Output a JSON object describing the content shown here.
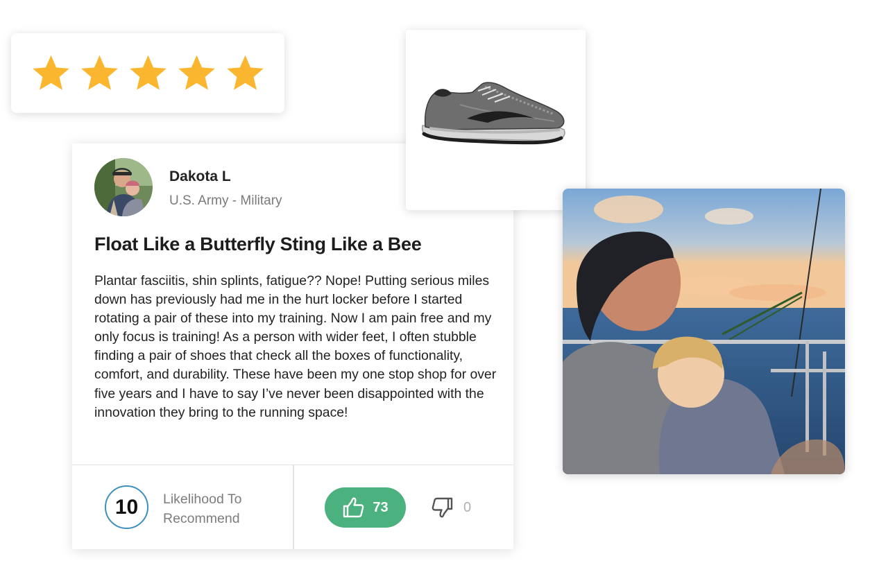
{
  "rating": {
    "stars": 5,
    "max_stars": 5,
    "star_color": "#fbb62f"
  },
  "reviewer": {
    "name": "Dakota L",
    "affiliation": "U.S. Army - Military"
  },
  "review": {
    "title": "Float Like a Butterfly Sting Like a Bee",
    "body": "Plantar fasciitis, shin splints, fatigue?? Nope! Putting serious miles down has previously had me in the hurt locker before I started rotating a pair of these into my training. Now I am pain free and my only focus is training! As a person with wider feet, I often stubble finding a pair of shoes that check all the boxes of functionality, comfort, and durability. These have been my one stop shop for over five years and I have to say I’ve never been disappointed with the innovation they bring to the running space!"
  },
  "score": {
    "value": "10",
    "label": "Likelihood To Recommend",
    "ring_color": "#3c8fbf"
  },
  "votes": {
    "helpful_count": "73",
    "unhelpful_count": "0",
    "helpful_color": "#4bb17e",
    "helpful_icon": "thumbs-up-icon",
    "unhelpful_icon": "thumbs-down-icon"
  }
}
